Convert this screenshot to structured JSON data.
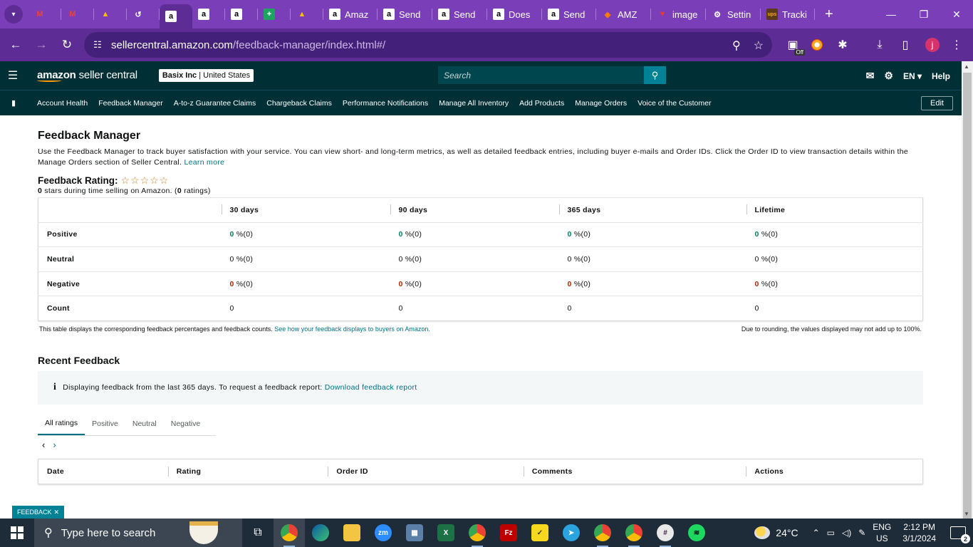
{
  "browser": {
    "tabs": [
      {
        "icon": "gmail-icon",
        "title": ""
      },
      {
        "icon": "gmail-icon",
        "title": ""
      },
      {
        "icon": "drive-icon",
        "title": ""
      },
      {
        "icon": "history-icon",
        "title": ""
      },
      {
        "icon": "amazon-icon",
        "title": "",
        "active": true
      },
      {
        "icon": "amazon-icon",
        "title": ""
      },
      {
        "icon": "amazon-icon",
        "title": ""
      },
      {
        "icon": "sheets-icon",
        "title": ""
      },
      {
        "icon": "drive-icon",
        "title": ""
      },
      {
        "icon": "amazon-icon",
        "title": "Amaz"
      },
      {
        "icon": "amazon-icon",
        "title": "Send"
      },
      {
        "icon": "amazon-icon",
        "title": "Send"
      },
      {
        "icon": "amazon-icon",
        "title": "Does"
      },
      {
        "icon": "amazon-icon",
        "title": "Send"
      },
      {
        "icon": "amz-tool-icon",
        "title": "AMZ"
      },
      {
        "icon": "image-icon",
        "title": "image"
      },
      {
        "icon": "settings-icon",
        "title": "Settin"
      },
      {
        "icon": "ups-icon",
        "title": "Tracki"
      }
    ],
    "url_host": "sellercentral.amazon.com",
    "url_path": "/feedback-manager/index.html#/",
    "profile_initial": "j",
    "ext_off_label": "Off"
  },
  "header": {
    "logo_bold": "amazon",
    "logo_light": " seller central",
    "store_name": "Basix Inc",
    "store_region": " | United States",
    "search_placeholder": "Search",
    "language": "EN",
    "help": "Help"
  },
  "nav": {
    "items": [
      "Account Health",
      "Feedback Manager",
      "A-to-z Guarantee Claims",
      "Chargeback Claims",
      "Performance Notifications",
      "Manage All Inventory",
      "Add Products",
      "Manage Orders",
      "Voice of the Customer"
    ],
    "edit": "Edit"
  },
  "page": {
    "title": "Feedback Manager",
    "intro": "Use the Feedback Manager to track buyer satisfaction with your service. You can view short- and long-term metrics, as well as detailed feedback entries, including buyer e-mails and Order IDs. Click the Order ID to view transaction details within the Manage Orders section of Seller Central.",
    "learn_more": "Learn more",
    "rating_label": "Feedback Rating:",
    "rating_stars": "☆☆☆☆☆",
    "rating_value": "0",
    "rating_text_1": " stars during time selling on Amazon. (",
    "rating_count": "0",
    "rating_text_2": " ratings)"
  },
  "metrics": {
    "periods": [
      "30 days",
      "90 days",
      "365 days",
      "Lifetime"
    ],
    "rows": [
      {
        "label": "Positive",
        "cells": [
          {
            "value": "0",
            "rest": " %(0)"
          },
          {
            "value": "0",
            "rest": " %(0)"
          },
          {
            "value": "0",
            "rest": " %(0)"
          },
          {
            "value": "0",
            "rest": " %(0)"
          }
        ]
      },
      {
        "label": "Neutral",
        "cells": [
          {
            "value": "0",
            "rest": " %(0)"
          },
          {
            "value": "0",
            "rest": " %(0)"
          },
          {
            "value": "0",
            "rest": " %(0)"
          },
          {
            "value": "0",
            "rest": " %(0)"
          }
        ]
      },
      {
        "label": "Negative",
        "cells": [
          {
            "value": "0",
            "rest": " %(0)"
          },
          {
            "value": "0",
            "rest": " %(0)"
          },
          {
            "value": "0",
            "rest": " %(0)"
          },
          {
            "value": "0",
            "rest": " %(0)"
          }
        ]
      },
      {
        "label": "Count",
        "cells": [
          {
            "value": "0",
            "rest": ""
          },
          {
            "value": "0",
            "rest": ""
          },
          {
            "value": "0",
            "rest": ""
          },
          {
            "value": "0",
            "rest": ""
          }
        ]
      }
    ],
    "note": "This table displays the corresponding feedback percentages and feedback counts.",
    "note_link": "See how your feedback displays to buyers on Amazon.",
    "rounding_note": "Due to rounding, the values displayed may not add up to 100%."
  },
  "recent": {
    "title": "Recent Feedback",
    "info_icon": "i",
    "alert_text": "Displaying feedback from the last 365 days. To request a feedback report:",
    "alert_link": "Download feedback report",
    "tabs": [
      "All ratings",
      "Positive",
      "Neutral",
      "Negative"
    ],
    "columns": [
      "Date",
      "Rating",
      "Order ID",
      "Comments",
      "Actions"
    ]
  },
  "feedback_tab": "FEEDBACK",
  "taskbar": {
    "search_placeholder": "Type here to search",
    "temperature": "24°C",
    "lang_1": "ENG",
    "lang_2": "US",
    "time": "2:12 PM",
    "date": "3/1/2024",
    "notification_count": "2"
  },
  "colors": {
    "tab_strip": "#7a3fb8",
    "address_bar": "#5d2d95",
    "seller_header": "#002f36",
    "link": "#007185",
    "positive": "#067d62",
    "negative": "#b12704",
    "taskbar": "#1e2b38"
  }
}
